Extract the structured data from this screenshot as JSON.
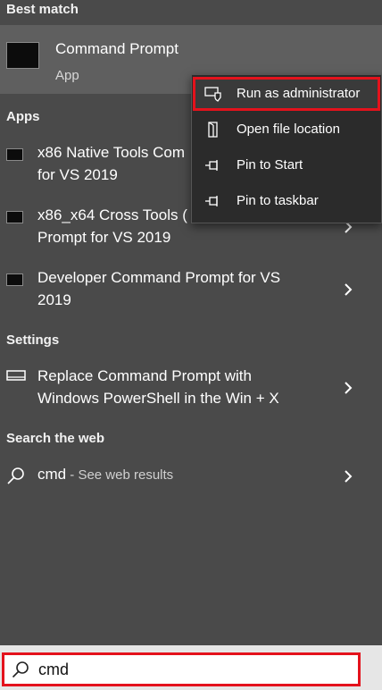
{
  "sections": {
    "best_match": "Best match",
    "apps": "Apps",
    "settings": "Settings",
    "search_web": "Search the web"
  },
  "best_match": {
    "title": "Command Prompt",
    "subtitle": "App"
  },
  "apps": [
    {
      "label": "x86 Native Tools Com\nfor VS 2019"
    },
    {
      "label": "x86_x64 Cross Tools (\nPrompt for VS 2019"
    },
    {
      "label": "Developer Command Prompt for VS\n2019"
    }
  ],
  "settings": [
    {
      "label": "Replace Command Prompt with\nWindows PowerShell in the Win + X"
    }
  ],
  "web": {
    "query": "cmd",
    "suffix": " - See web results"
  },
  "context_menu": [
    {
      "label": "Run as administrator",
      "icon": "shield-icon"
    },
    {
      "label": "Open file location",
      "icon": "folder-icon"
    },
    {
      "label": "Pin to Start",
      "icon": "pin-icon"
    },
    {
      "label": "Pin to taskbar",
      "icon": "pin-icon"
    }
  ],
  "search": {
    "value": "cmd"
  },
  "colors": {
    "highlight": "#e4121c",
    "panel": "#4a4a4a",
    "menu": "#2b2b2b"
  }
}
